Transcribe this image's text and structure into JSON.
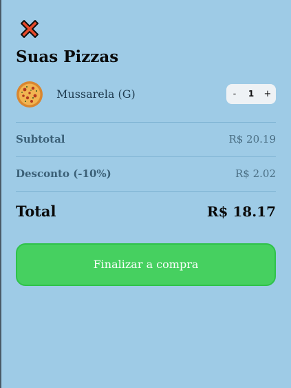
{
  "cart": {
    "close_icon": "close-x-icon",
    "title": "Suas Pizzas",
    "items": [
      {
        "image": "pizza-icon",
        "name": "Mussarela (G)",
        "quantity": "1",
        "decrement_label": "-",
        "increment_label": "+"
      }
    ],
    "subtotal_label": "Subtotal",
    "subtotal_value": "R$ 20.19",
    "discount_label": "Desconto (-10%)",
    "discount_value": "R$ 2.02",
    "total_label": "Total",
    "total_value": "R$ 18.17",
    "finish_label": "Finalizar a compra"
  },
  "colors": {
    "background": "#9ecbe6",
    "button": "#46d060",
    "close_icon": "#e84a2a"
  }
}
